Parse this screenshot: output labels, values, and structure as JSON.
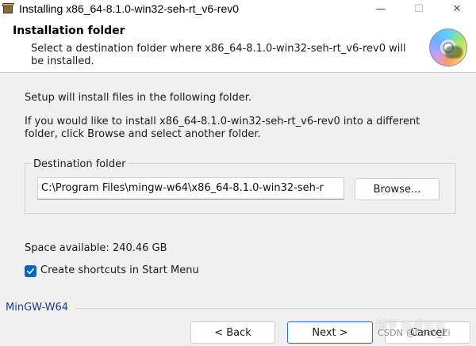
{
  "window": {
    "title": "Installing x86_64-8.1.0-win32-seh-rt_v6-rev0",
    "minimize_glyph": "—",
    "maximize_glyph": "☐",
    "close_glyph": "✕"
  },
  "header": {
    "title": "Installation folder",
    "subtitle": "Select a destination folder where x86_64-8.1.0-win32-seh-rt_v6-rev0 will be installed.",
    "icon": "cd-disc-icon"
  },
  "body": {
    "intro": "Setup will install files in the following folder.",
    "instructions": "If you would like to install x86_64-8.1.0-win32-seh-rt_v6-rev0 into a different folder, click Browse and select another folder."
  },
  "destination": {
    "group_label": "Destination folder",
    "path_value": "C:\\Program Files\\mingw-w64\\x86_64-8.1.0-win32-seh-r",
    "browse_label": "Browse..."
  },
  "space_available": "Space available: 240.46 GB",
  "shortcuts": {
    "label": "Create shortcuts in Start Menu",
    "checked": true
  },
  "footer": {
    "brand": "MinGW-W64",
    "back_label": "< Back",
    "next_label": "Next >",
    "cancel_label": "Cancel"
  },
  "watermark": {
    "line1": "知乎 @凌云云",
    "line2": "CSDN @Coco_Zi"
  },
  "colors": {
    "accent": "#0067c0",
    "brand": "#1c3c8c"
  }
}
